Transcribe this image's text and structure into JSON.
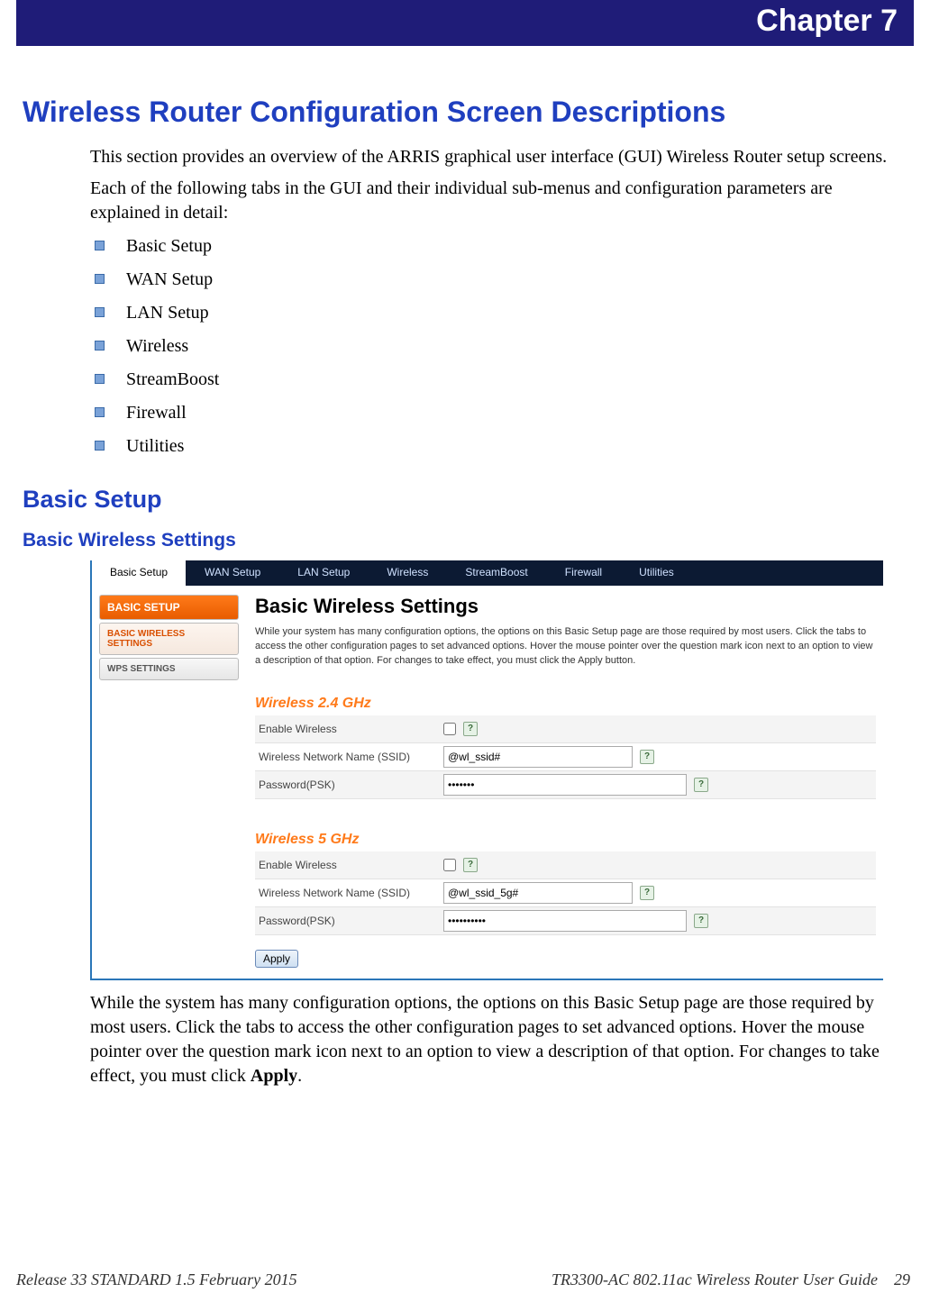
{
  "chapter_banner": "Chapter 7",
  "heading_main": "Wireless Router Configuration Screen Descriptions",
  "intro_para_1": "This section provides an overview of the ARRIS graphical user interface (GUI) Wireless Router setup screens.",
  "intro_para_2": "Each of the following tabs in the GUI and their individual sub-menus and configuration parameters are explained in detail:",
  "tab_list": [
    "Basic Setup",
    "WAN Setup",
    "LAN Setup",
    "Wireless",
    "StreamBoost",
    "Firewall",
    "Utilities"
  ],
  "heading_basic_setup": "Basic Setup",
  "heading_basic_wireless": "Basic Wireless Settings",
  "screenshot": {
    "topnav": [
      "Basic Setup",
      "WAN Setup",
      "LAN Setup",
      "Wireless",
      "StreamBoost",
      "Firewall",
      "Utilities"
    ],
    "topnav_active_index": 0,
    "sidebar": {
      "primary": "BASIC SETUP",
      "items": [
        "BASIC WIRELESS SETTINGS",
        "WPS SETTINGS"
      ],
      "active_index": 0
    },
    "panel_title": "Basic Wireless Settings",
    "panel_desc": "While your system has many configuration options, the options on this Basic Setup page are those required by most users. Click the tabs to access the other configuration pages to set advanced options. Hover the mouse pointer over the question mark icon next to an option to view a description of that option. For changes to take effect, you must click the Apply button.",
    "group24": {
      "title": "Wireless 2.4 GHz",
      "enable_label": "Enable Wireless",
      "enable_checked": false,
      "ssid_label": "Wireless Network Name (SSID)",
      "ssid_value": "@wl_ssid#",
      "psk_label": "Password(PSK)",
      "psk_value": "•••••••"
    },
    "group5": {
      "title": "Wireless 5 GHz",
      "enable_label": "Enable Wireless",
      "enable_checked": false,
      "ssid_label": "Wireless Network Name (SSID)",
      "ssid_value": "@wl_ssid_5g#",
      "psk_label": "Password(PSK)",
      "psk_value": "••••••••••"
    },
    "apply_label": "Apply",
    "help_glyph": "?"
  },
  "closing_para_prefix": "While the system has many configuration options, the options on this Basic Setup page are those required by most users. Click the tabs to access the other configuration pages to set advanced options. Hover the mouse pointer over the question mark icon next to an option to view a description of that option. For changes to take effect, you must click ",
  "closing_para_bold": "Apply",
  "closing_para_suffix": ".",
  "footer": {
    "left": "Release 33 STANDARD 1.5    February 2015",
    "right_title": "TR3300-AC 802.11ac Wireless Router User Guide",
    "page": "29"
  }
}
